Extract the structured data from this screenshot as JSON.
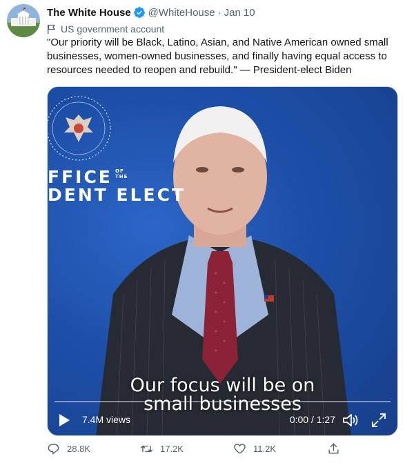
{
  "tweet": {
    "display_name": "The White House",
    "handle": "@WhiteHouse",
    "separator": "·",
    "time": "Jan 10",
    "account_label": "US government account",
    "text": "\"Our priority will be Black, Latino, Asian, and Native American owned small\nbusinesses, women-owned businesses, and finally having equal access to\nresources needed to reopen and rebuild.\" — President-elect Biden"
  },
  "media": {
    "backdrop_line1": "FFICE",
    "backdrop_small": "OF\nTHE",
    "backdrop_line2": "DENT ELECT",
    "caption_line1": "Our focus will be on",
    "caption_line2": "small businesses",
    "views": "7.4M views",
    "timecode": "0:00 / 1:27",
    "progress": 0,
    "icons": [
      "play-icon",
      "volume-icon",
      "expand-icon"
    ]
  },
  "actions": {
    "reply_count": "28.8K",
    "retweet_count": "17.2K",
    "like_count": "11.2K"
  },
  "colors": {
    "accent": "#1d9bf0",
    "secondary_text": "#536471",
    "primary_text": "#0f1419",
    "video_background": "#1d4fa8"
  }
}
